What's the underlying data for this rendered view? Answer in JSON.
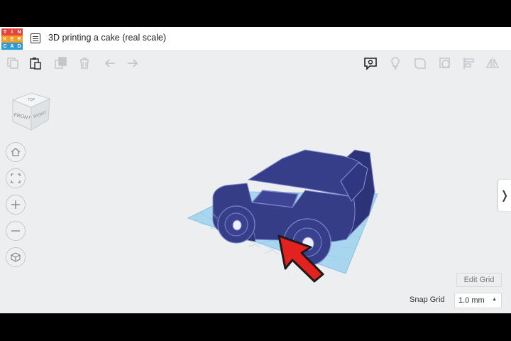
{
  "app": {
    "logo_letters": [
      "T",
      "I",
      "N",
      "K",
      "E",
      "R",
      "C",
      "A",
      "D"
    ],
    "logo_colors": [
      "#e2473f",
      "#e2473f",
      "#e2473f",
      "#f59a23",
      "#f59a23",
      "#f59a23",
      "#2e9bd6",
      "#2e9bd6",
      "#2e9bd6"
    ],
    "document_title": "3D printing a cake (real scale)"
  },
  "toolbar": {
    "left_tools": [
      "copy-icon",
      "paste-icon",
      "duplicate-icon",
      "delete-icon",
      "undo-icon",
      "redo-icon"
    ],
    "right_tools": [
      "comment-icon",
      "lightbulb-icon",
      "shape-solid-icon",
      "shape-hole-icon",
      "align-icon",
      "mirror-icon"
    ]
  },
  "viewcube": {
    "top": "TOP",
    "front": "FRONT",
    "right": "RIGHT"
  },
  "view_controls": [
    "home-view-icon",
    "fit-view-icon",
    "zoom-in-icon",
    "zoom-out-icon",
    "projection-icon"
  ],
  "workplane": {
    "edit_grid_label": "Edit Grid",
    "snap_grid_label": "Snap Grid",
    "snap_grid_value": "1.0 mm"
  },
  "colors": {
    "model": "#353d86",
    "model_edge": "#7c86c9",
    "workplane": "#a9d6ef",
    "arrow": "#e3211e"
  }
}
